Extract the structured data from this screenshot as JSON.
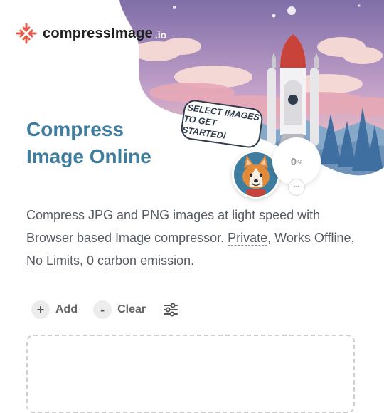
{
  "brand": {
    "name": "compressImage",
    "tld": ".io",
    "accent": "#e35b47"
  },
  "hero": {
    "heading_line1": "Compress",
    "heading_line2": "Image Online",
    "cta_line1": "SELECT IMAGES",
    "cta_line2": "TO GET STARTED!",
    "progress_value": "0",
    "progress_unit": "%",
    "more": "..."
  },
  "description": {
    "part1": "Compress JPG and PNG images at light speed with Browser based Image compressor. ",
    "private": "Private",
    "sep1": ", Works Offline, ",
    "no_limits": "No Limits",
    "sep2": ", 0 ",
    "carbon": "carbon emission",
    "end": "."
  },
  "toolbar": {
    "add_symbol": "+",
    "add_label": "Add",
    "clear_symbol": "-",
    "clear_label": "Clear",
    "settings_icon": "sliders-icon"
  },
  "colors": {
    "heading": "#3f7da0",
    "text": "#555b62"
  }
}
